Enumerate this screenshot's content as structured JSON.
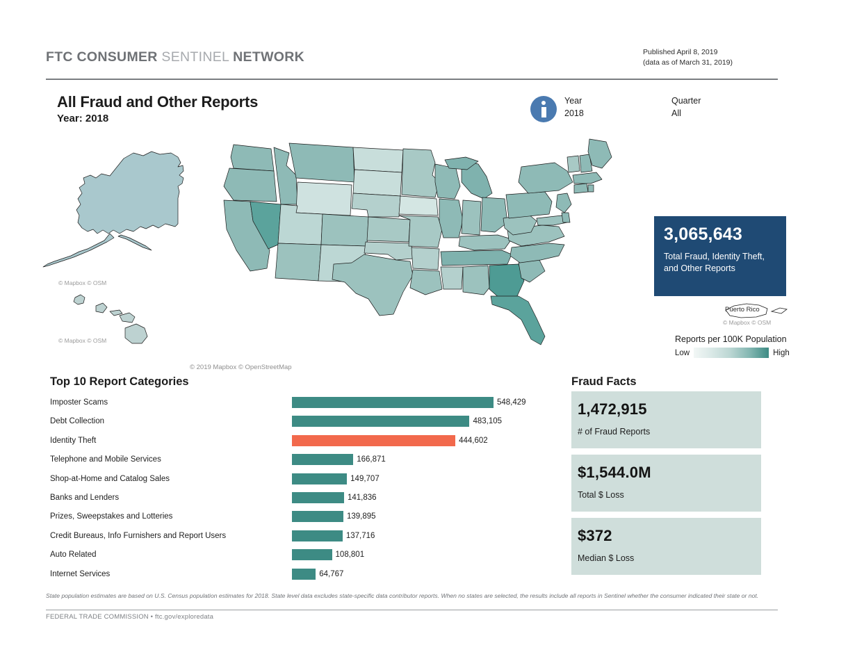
{
  "header": {
    "brand_bold_1": "FTC CONSUMER ",
    "brand_light": "SENTINEL ",
    "brand_bold_2": "NETWORK",
    "published": "Published April 8, 2019",
    "data_as_of": "(data as of March 31, 2019)"
  },
  "title": {
    "main": "All Fraud and Other Reports",
    "sub": "Year: 2018"
  },
  "filters": {
    "info_icon": "info-icon",
    "year_label": "Year",
    "year_value": "2018",
    "quarter_label": "Quarter",
    "quarter_value": "All"
  },
  "map": {
    "attrib_alaska": "© Mapbox © OSM",
    "attrib_hawaii": "© Mapbox © OSM",
    "attrib_puerto_rico": "© Mapbox © OSM",
    "attrib_main": "© 2019 Mapbox © OpenStreetMap",
    "puerto_rico_label": "Puerto Rico",
    "legend_title": "Reports per 100K Population",
    "legend_low": "Low",
    "legend_high": "High",
    "legend_color_low": "#f2f7f6",
    "legend_color_high": "#3d8b84"
  },
  "total_callout": {
    "value": "3,065,643",
    "label": "Total Fraud, Identity Theft, and Other Reports",
    "background": "#1f4a74"
  },
  "chart_data": {
    "type": "bar",
    "title": "Top 10 Report Categories",
    "orientation": "horizontal",
    "xlabel": "",
    "ylabel": "",
    "grid": false,
    "legend": "none",
    "bar_color": "#3d8b84",
    "highlight_color": "#f2694c",
    "highlight_category": "Identity Theft",
    "xlim": [
      0,
      548429
    ],
    "categories": [
      "Imposter Scams",
      "Debt Collection",
      "Identity Theft",
      "Telephone and Mobile Services",
      "Shop-at-Home and Catalog Sales",
      "Banks and Lenders",
      "Prizes, Sweepstakes and Lotteries",
      "Credit Bureaus, Info Furnishers and Report Users",
      "Auto Related",
      "Internet Services"
    ],
    "values": [
      548429,
      483105,
      444602,
      166871,
      149707,
      141836,
      139895,
      137716,
      108801,
      64767
    ],
    "value_labels": [
      "548,429",
      "483,105",
      "444,602",
      "166,871",
      "149,707",
      "141,836",
      "139,895",
      "137,716",
      "108,801",
      "64,767"
    ]
  },
  "fraud_facts": {
    "title": "Fraud Facts",
    "card_background": "#cfdedb",
    "cards": [
      {
        "value": "1,472,915",
        "label": "# of Fraud Reports"
      },
      {
        "value": "$1,544.0M",
        "label": "Total $ Loss"
      },
      {
        "value": "$372",
        "label": "Median $ Loss"
      }
    ]
  },
  "footnote": "State population estimates are based on U.S. Census population estimates for 2018. State level data excludes state-specific data contributor reports. When no states are selected, the results include all reports in Sentinel whether the consumer indicated their state or not.",
  "footer": "FEDERAL TRADE COMMISSION • ftc.gov/exploredata"
}
